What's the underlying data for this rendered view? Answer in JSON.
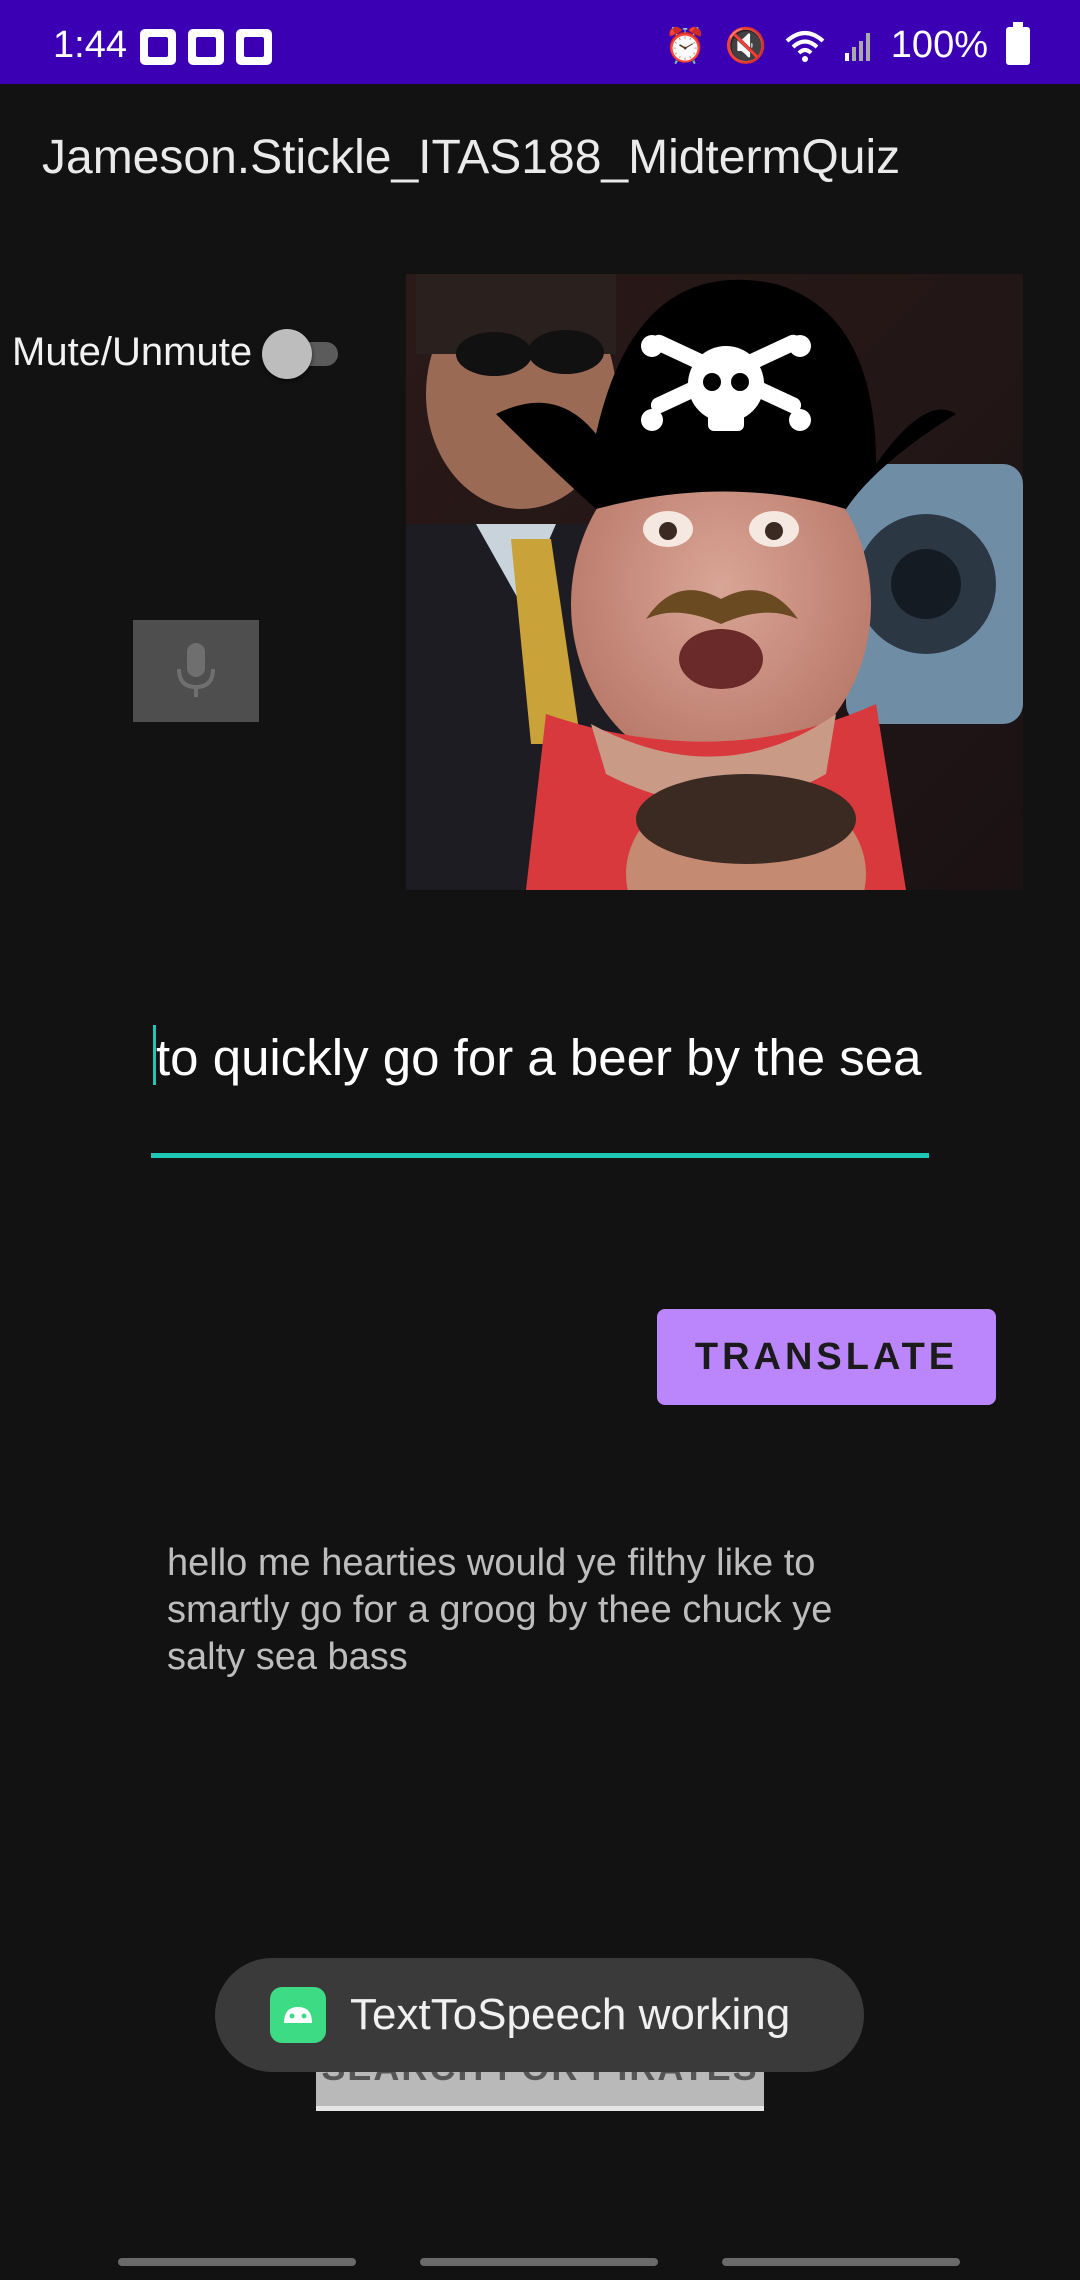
{
  "status_bar": {
    "time": "1:44",
    "battery": "100%",
    "background": "#3b00b3",
    "left_icons": [
      "trophy-icon",
      "calendar-icon",
      "trophy-icon"
    ],
    "right_icons": [
      "alarm-icon",
      "mute-icon",
      "wifi-icon",
      "signal-icon",
      "battery-icon"
    ]
  },
  "app": {
    "title": "Jameson.Stickle_ITAS188_MidtermQuiz"
  },
  "controls": {
    "mute_label": "Mute/Unmute",
    "mute_on": false
  },
  "input": {
    "value": "to quickly go for a beer by the sea",
    "accent": "#21c7b6"
  },
  "translate_button": {
    "label": "TRANSLATE",
    "color": "#bb86fc"
  },
  "output": {
    "text": "hello me hearties would ye filthy like to smartly go for a groog by thee chuck ye salty sea bass"
  },
  "search_button": {
    "label": "SEARCH FOR PIRATES"
  },
  "toast": {
    "text": "TextToSpeech working"
  }
}
